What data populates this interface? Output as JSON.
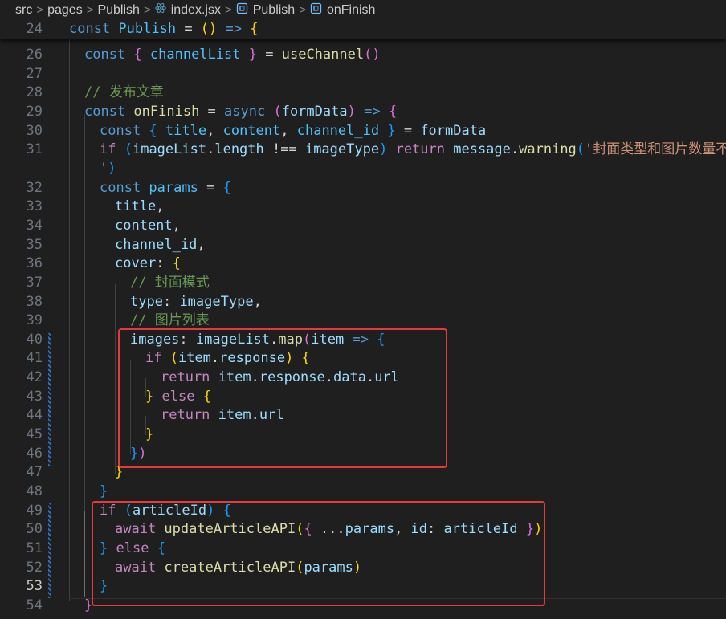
{
  "breadcrumb": {
    "items": [
      "src",
      "pages",
      "Publish",
      "index.jsx",
      "Publish",
      "onFinish"
    ],
    "separator": ">"
  },
  "colors": {
    "background": "#1f1f1f",
    "keyword": "#569cd6",
    "control_keyword": "#c586c0",
    "variable": "#9cdcfe",
    "constant": "#4fc1ff",
    "function": "#dcdcaa",
    "string": "#ce9178",
    "comment": "#6a9955",
    "annotation_box": "#e8383d"
  },
  "editor": {
    "active_line": "53",
    "lines": [
      {
        "no": "24",
        "tokens": [
          [
            "k",
            "const "
          ],
          [
            "c",
            "Publish"
          ],
          [
            "o",
            " = "
          ],
          [
            "b1",
            "()"
          ],
          [
            "o",
            " "
          ],
          [
            "k",
            "=>"
          ],
          [
            "o",
            " "
          ],
          [
            "b1",
            "{"
          ]
        ]
      },
      {
        "no": "26",
        "tokens": [
          [
            "k",
            "const "
          ],
          [
            "b2",
            "{"
          ],
          [
            "o",
            " "
          ],
          [
            "c",
            "channelList"
          ],
          [
            "o",
            " "
          ],
          [
            "b2",
            "}"
          ],
          [
            "o",
            " = "
          ],
          [
            "f",
            "useChannel"
          ],
          [
            "b2",
            "()"
          ]
        ]
      },
      {
        "no": "27",
        "tokens": []
      },
      {
        "no": "28",
        "tokens": [
          [
            "cm",
            "// 发布文章"
          ]
        ]
      },
      {
        "no": "29",
        "tokens": [
          [
            "k",
            "const "
          ],
          [
            "f",
            "onFinish"
          ],
          [
            "o",
            " = "
          ],
          [
            "k",
            "async "
          ],
          [
            "b2",
            "("
          ],
          [
            "v",
            "formData"
          ],
          [
            "b2",
            ")"
          ],
          [
            "o",
            " "
          ],
          [
            "k",
            "=>"
          ],
          [
            "o",
            " "
          ],
          [
            "b2",
            "{"
          ]
        ]
      },
      {
        "no": "30",
        "tokens": [
          [
            "k",
            "const "
          ],
          [
            "b3",
            "{"
          ],
          [
            "o",
            " "
          ],
          [
            "c",
            "title"
          ],
          [
            "o",
            ", "
          ],
          [
            "c",
            "content"
          ],
          [
            "o",
            ", "
          ],
          [
            "c",
            "channel_id"
          ],
          [
            "o",
            " "
          ],
          [
            "b3",
            "}"
          ],
          [
            "o",
            " = "
          ],
          [
            "v",
            "formData"
          ]
        ]
      },
      {
        "no": "31",
        "tokens": [
          [
            "kc",
            "if "
          ],
          [
            "b3",
            "("
          ],
          [
            "v",
            "imageList"
          ],
          [
            "o",
            "."
          ],
          [
            "v",
            "length"
          ],
          [
            "o",
            " !== "
          ],
          [
            "v",
            "imageType"
          ],
          [
            "b3",
            ")"
          ],
          [
            "o",
            " "
          ],
          [
            "kc",
            "return "
          ],
          [
            "v",
            "message"
          ],
          [
            "o",
            "."
          ],
          [
            "f",
            "warning"
          ],
          [
            "b3",
            "("
          ],
          [
            "s",
            "'封面类型和图片数量不匹配"
          ]
        ]
      },
      {
        "no": "",
        "tokens": [
          [
            "s",
            "'"
          ],
          [
            "b3",
            ")"
          ]
        ]
      },
      {
        "no": "32",
        "tokens": [
          [
            "k",
            "const "
          ],
          [
            "c",
            "params"
          ],
          [
            "o",
            " = "
          ],
          [
            "b3",
            "{"
          ]
        ]
      },
      {
        "no": "33",
        "tokens": [
          [
            "v",
            "title"
          ],
          [
            "o",
            ","
          ]
        ]
      },
      {
        "no": "34",
        "tokens": [
          [
            "v",
            "content"
          ],
          [
            "o",
            ","
          ]
        ]
      },
      {
        "no": "35",
        "tokens": [
          [
            "v",
            "channel_id"
          ],
          [
            "o",
            ","
          ]
        ]
      },
      {
        "no": "36",
        "tokens": [
          [
            "v",
            "cover"
          ],
          [
            "o",
            ": "
          ],
          [
            "b1",
            "{"
          ]
        ]
      },
      {
        "no": "37",
        "tokens": [
          [
            "cm",
            "// 封面模式"
          ]
        ]
      },
      {
        "no": "38",
        "tokens": [
          [
            "v",
            "type"
          ],
          [
            "o",
            ": "
          ],
          [
            "v",
            "imageType"
          ],
          [
            "o",
            ","
          ]
        ]
      },
      {
        "no": "39",
        "tokens": [
          [
            "cm",
            "// 图片列表"
          ]
        ]
      },
      {
        "no": "40",
        "tokens": [
          [
            "v",
            "images"
          ],
          [
            "o",
            ": "
          ],
          [
            "v",
            "imageList"
          ],
          [
            "o",
            "."
          ],
          [
            "f",
            "map"
          ],
          [
            "b2",
            "("
          ],
          [
            "v",
            "item"
          ],
          [
            "o",
            " "
          ],
          [
            "k",
            "=>"
          ],
          [
            "o",
            " "
          ],
          [
            "b3",
            "{"
          ]
        ]
      },
      {
        "no": "41",
        "tokens": [
          [
            "kc",
            "if "
          ],
          [
            "b1",
            "("
          ],
          [
            "v",
            "item"
          ],
          [
            "o",
            "."
          ],
          [
            "v",
            "response"
          ],
          [
            "b1",
            ")"
          ],
          [
            "o",
            " "
          ],
          [
            "b1",
            "{"
          ]
        ]
      },
      {
        "no": "42",
        "tokens": [
          [
            "kc",
            "return "
          ],
          [
            "v",
            "item"
          ],
          [
            "o",
            "."
          ],
          [
            "v",
            "response"
          ],
          [
            "o",
            "."
          ],
          [
            "v",
            "data"
          ],
          [
            "o",
            "."
          ],
          [
            "v",
            "url"
          ]
        ]
      },
      {
        "no": "43",
        "tokens": [
          [
            "b1",
            "}"
          ],
          [
            "o",
            " "
          ],
          [
            "kc",
            "else "
          ],
          [
            "b1",
            "{"
          ]
        ]
      },
      {
        "no": "44",
        "tokens": [
          [
            "kc",
            "return "
          ],
          [
            "v",
            "item"
          ],
          [
            "o",
            "."
          ],
          [
            "v",
            "url"
          ]
        ]
      },
      {
        "no": "45",
        "tokens": [
          [
            "b1",
            "}"
          ]
        ]
      },
      {
        "no": "46",
        "tokens": [
          [
            "b3",
            "}"
          ],
          [
            "b2",
            ")"
          ]
        ]
      },
      {
        "no": "47",
        "tokens": [
          [
            "b1",
            "}"
          ]
        ]
      },
      {
        "no": "48",
        "tokens": [
          [
            "b3",
            "}"
          ]
        ]
      },
      {
        "no": "49",
        "tokens": [
          [
            "kc",
            "if "
          ],
          [
            "b3",
            "("
          ],
          [
            "v",
            "articleId"
          ],
          [
            "b3",
            ")"
          ],
          [
            "o",
            " "
          ],
          [
            "b3",
            "{"
          ]
        ]
      },
      {
        "no": "50",
        "tokens": [
          [
            "kc",
            "await "
          ],
          [
            "f",
            "updateArticleAPI"
          ],
          [
            "b1",
            "("
          ],
          [
            "b2",
            "{"
          ],
          [
            "o",
            " ..."
          ],
          [
            "v",
            "params"
          ],
          [
            "o",
            ", "
          ],
          [
            "v",
            "id"
          ],
          [
            "o",
            ": "
          ],
          [
            "v",
            "articleId"
          ],
          [
            "o",
            " "
          ],
          [
            "b2",
            "}"
          ],
          [
            "b1",
            ")"
          ]
        ]
      },
      {
        "no": "51",
        "tokens": [
          [
            "b3",
            "}"
          ],
          [
            "o",
            " "
          ],
          [
            "kc",
            "else "
          ],
          [
            "b3",
            "{"
          ]
        ]
      },
      {
        "no": "52",
        "tokens": [
          [
            "kc",
            "await "
          ],
          [
            "f",
            "createArticleAPI"
          ],
          [
            "b1",
            "("
          ],
          [
            "v",
            "params"
          ],
          [
            "b1",
            ")"
          ]
        ]
      },
      {
        "no": "53",
        "tokens": [
          [
            "b3",
            "}"
          ]
        ]
      },
      {
        "no": "54",
        "tokens": [
          [
            "b2",
            "}"
          ]
        ]
      }
    ]
  }
}
